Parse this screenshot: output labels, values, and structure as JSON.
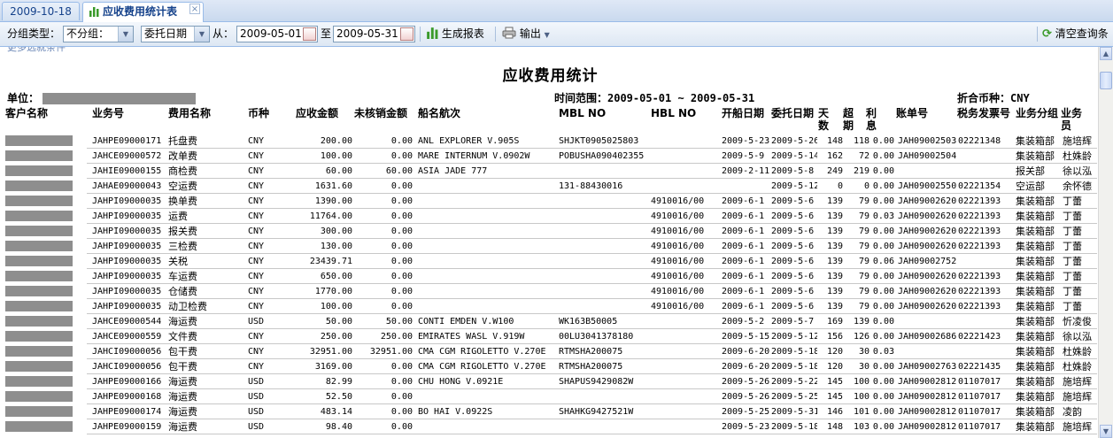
{
  "tabs": [
    {
      "label": "2009-10-18",
      "active": false
    },
    {
      "label": "应收费用统计表",
      "active": true
    }
  ],
  "toolbar": {
    "group_label": "分组类型：",
    "group_value": "不分组：",
    "date_type_value": "委托日期",
    "from_label": "从：",
    "from_date": "2009-05-01",
    "to_label": "至",
    "to_date": "2009-05-31",
    "generate_label": "生成报表",
    "export_label": "输出",
    "clear_label": "清空查询条"
  },
  "report": {
    "hint": "更多选就条件",
    "title": "应收费用统计",
    "unit_label": "单位：",
    "range_label": "时间范围：2009-05-01 ~ 2009-05-31",
    "currency_label": "折合币种：CNY",
    "headers": [
      "客户名称",
      "业务号",
      "费用名称",
      "币种",
      "应收金额",
      "未核销金额",
      "船名航次",
      "MBL NO",
      "HBL NO",
      "开船日期",
      "委托日期",
      "天数",
      "超期",
      "利息",
      "账单号",
      "税务发票号",
      "业务分组",
      "业务员"
    ],
    "rows": [
      [
        "JAHPE09000171",
        "托盘费",
        "CNY",
        "200.00",
        "0.00",
        "ANL EXPLORER V.905S",
        "SHJKT0905025803",
        "",
        "2009-5-23",
        "2009-5-26",
        "148",
        "118",
        "0.00",
        "JAH09002503",
        "02221348",
        "集装箱部",
        "施培辉"
      ],
      [
        "JAHCE09000572",
        "改单费",
        "CNY",
        "100.00",
        "0.00",
        "MARE INTERNUM V.0902W",
        "POBUSHA090402355",
        "",
        "2009-5-9",
        "2009-5-14",
        "162",
        "72",
        "0.00",
        "JAH09002504",
        "",
        "集装箱部",
        "杜姝龄"
      ],
      [
        "JAHIE09000155",
        "商检费",
        "CNY",
        "60.00",
        "60.00",
        "ASIA JADE 777",
        "",
        "",
        "2009-2-11",
        "2009-5-8",
        "249",
        "219",
        "0.00",
        "",
        "",
        "报关部",
        "徐以泓"
      ],
      [
        "JAHAE09000043",
        "空运费",
        "CNY",
        "1631.60",
        "0.00",
        "",
        "131-88430016",
        "",
        "",
        "2009-5-12",
        "0",
        "0",
        "0.00",
        "JAH09002550",
        "02221354",
        "空运部",
        "余怀德"
      ],
      [
        "JAHPI09000035",
        "换单费",
        "CNY",
        "1390.00",
        "0.00",
        "",
        "",
        "4910016/00",
        "2009-6-1",
        "2009-5-6",
        "139",
        "79",
        "0.00",
        "JAH09002620",
        "02221393",
        "集装箱部",
        "丁蕾"
      ],
      [
        "JAHPI09000035",
        "运费",
        "CNY",
        "11764.00",
        "0.00",
        "",
        "",
        "4910016/00",
        "2009-6-1",
        "2009-5-6",
        "139",
        "79",
        "0.03",
        "JAH09002620",
        "02221393",
        "集装箱部",
        "丁蕾"
      ],
      [
        "JAHPI09000035",
        "报关费",
        "CNY",
        "300.00",
        "0.00",
        "",
        "",
        "4910016/00",
        "2009-6-1",
        "2009-5-6",
        "139",
        "79",
        "0.00",
        "JAH09002620",
        "02221393",
        "集装箱部",
        "丁蕾"
      ],
      [
        "JAHPI09000035",
        "三检费",
        "CNY",
        "130.00",
        "0.00",
        "",
        "",
        "4910016/00",
        "2009-6-1",
        "2009-5-6",
        "139",
        "79",
        "0.00",
        "JAH09002620",
        "02221393",
        "集装箱部",
        "丁蕾"
      ],
      [
        "JAHPI09000035",
        "关税",
        "CNY",
        "23439.71",
        "0.00",
        "",
        "",
        "4910016/00",
        "2009-6-1",
        "2009-5-6",
        "139",
        "79",
        "0.06",
        "JAH09002752",
        "",
        "集装箱部",
        "丁蕾"
      ],
      [
        "JAHPI09000035",
        "车运费",
        "CNY",
        "650.00",
        "0.00",
        "",
        "",
        "4910016/00",
        "2009-6-1",
        "2009-5-6",
        "139",
        "79",
        "0.00",
        "JAH09002620",
        "02221393",
        "集装箱部",
        "丁蕾"
      ],
      [
        "JAHPI09000035",
        "仓储费",
        "CNY",
        "1770.00",
        "0.00",
        "",
        "",
        "4910016/00",
        "2009-6-1",
        "2009-5-6",
        "139",
        "79",
        "0.00",
        "JAH09002620",
        "02221393",
        "集装箱部",
        "丁蕾"
      ],
      [
        "JAHPI09000035",
        "动卫检费",
        "CNY",
        "100.00",
        "0.00",
        "",
        "",
        "4910016/00",
        "2009-6-1",
        "2009-5-6",
        "139",
        "79",
        "0.00",
        "JAH09002620",
        "02221393",
        "集装箱部",
        "丁蕾"
      ],
      [
        "JAHCE09000544",
        "海运费",
        "USD",
        "50.00",
        "50.00",
        "CONTI EMDEN V.W100",
        "WK163B50005",
        "",
        "2009-5-2",
        "2009-5-7",
        "169",
        "139",
        "0.00",
        "",
        "",
        "集装箱部",
        "忻凌俊"
      ],
      [
        "JAHCE09000559",
        "文件费",
        "CNY",
        "250.00",
        "250.00",
        "EMIRATES WASL V.919W",
        "00LU3041378180",
        "",
        "2009-5-15",
        "2009-5-12",
        "156",
        "126",
        "0.00",
        "JAH09002686",
        "02221423",
        "集装箱部",
        "徐以泓"
      ],
      [
        "JAHCI09000056",
        "包干费",
        "CNY",
        "32951.00",
        "32951.00",
        "CMA CGM RIGOLETTO V.270E",
        "RTMSHA200075",
        "",
        "2009-6-20",
        "2009-5-18",
        "120",
        "30",
        "0.03",
        "",
        "",
        "集装箱部",
        "杜姝龄"
      ],
      [
        "JAHCI09000056",
        "包干费",
        "CNY",
        "3169.00",
        "0.00",
        "CMA CGM RIGOLETTO V.270E",
        "RTMSHA200075",
        "",
        "2009-6-20",
        "2009-5-18",
        "120",
        "30",
        "0.00",
        "JAH09002763",
        "02221435",
        "集装箱部",
        "杜姝龄"
      ],
      [
        "JAHPE09000166",
        "海运费",
        "USD",
        "82.99",
        "0.00",
        "CHU HONG V.0921E",
        "SHAPUS9429082W",
        "",
        "2009-5-26",
        "2009-5-22",
        "145",
        "100",
        "0.00",
        "JAH09002812",
        "01107017",
        "集装箱部",
        "施培辉"
      ],
      [
        "JAHPE09000168",
        "海运费",
        "USD",
        "52.50",
        "0.00",
        "",
        "",
        "",
        "2009-5-26",
        "2009-5-25",
        "145",
        "100",
        "0.00",
        "JAH09002812",
        "01107017",
        "集装箱部",
        "施培辉"
      ],
      [
        "JAHPE09000174",
        "海运费",
        "USD",
        "483.14",
        "0.00",
        "BO HAI V.0922S",
        "SHAHKG9427521W",
        "",
        "2009-5-25",
        "2009-5-31",
        "146",
        "101",
        "0.00",
        "JAH09002812",
        "01107017",
        "集装箱部",
        "凌韵"
      ],
      [
        "JAHPE09000159",
        "海运费",
        "USD",
        "98.40",
        "0.00",
        "",
        "",
        "",
        "2009-5-23",
        "2009-5-18",
        "148",
        "103",
        "0.00",
        "JAH09002812",
        "01107017",
        "集装箱部",
        "施培辉"
      ]
    ]
  },
  "colors": {
    "header_blue": "#dfe8f6",
    "tab_text": "#15428b",
    "green_icon": "#3a9a2a",
    "masked_grey": "#8e8e8e"
  }
}
